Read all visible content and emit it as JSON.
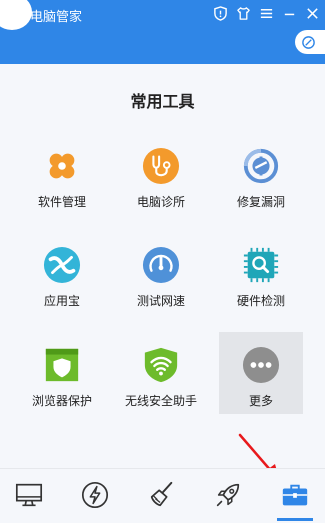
{
  "titlebar": {
    "title": "电脑管家",
    "icons": [
      "shield-icon",
      "shirt-icon",
      "menu-icon",
      "minimize-icon",
      "close-icon"
    ],
    "pill_icon": "gpu-icon",
    "bg_color": "#2f86e7"
  },
  "section": {
    "title": "常用工具"
  },
  "tools": [
    {
      "label": "软件管理",
      "icon": "software-manager-icon",
      "color": "#f39a2c"
    },
    {
      "label": "电脑诊所",
      "icon": "stethoscope-icon",
      "color": "#f39a2c"
    },
    {
      "label": "修复漏洞",
      "icon": "repair-icon",
      "color": "#5b8fd4"
    },
    {
      "label": "应用宝",
      "icon": "app-store-icon",
      "color": "#33b4d8"
    },
    {
      "label": "测试网速",
      "icon": "speedometer-icon",
      "color": "#4f91d8"
    },
    {
      "label": "硬件检测",
      "icon": "chip-search-icon",
      "color": "#1fa6b8"
    },
    {
      "label": "浏览器保护",
      "icon": "browser-shield-icon",
      "color": "#6dbb2b"
    },
    {
      "label": "无线安全助手",
      "icon": "wifi-shield-icon",
      "color": "#6dbb2b"
    },
    {
      "label": "更多",
      "icon": "more-icon",
      "color": "#8e8e8e"
    }
  ],
  "selected_tool": "更多",
  "bottom_nav": [
    {
      "name": "monitor-icon"
    },
    {
      "name": "lightning-icon"
    },
    {
      "name": "broom-icon"
    },
    {
      "name": "rocket-icon"
    },
    {
      "name": "toolbox-icon",
      "active": true
    }
  ],
  "accent": "#2f86e7",
  "annotation": {
    "arrow_color": "#e8191c"
  }
}
